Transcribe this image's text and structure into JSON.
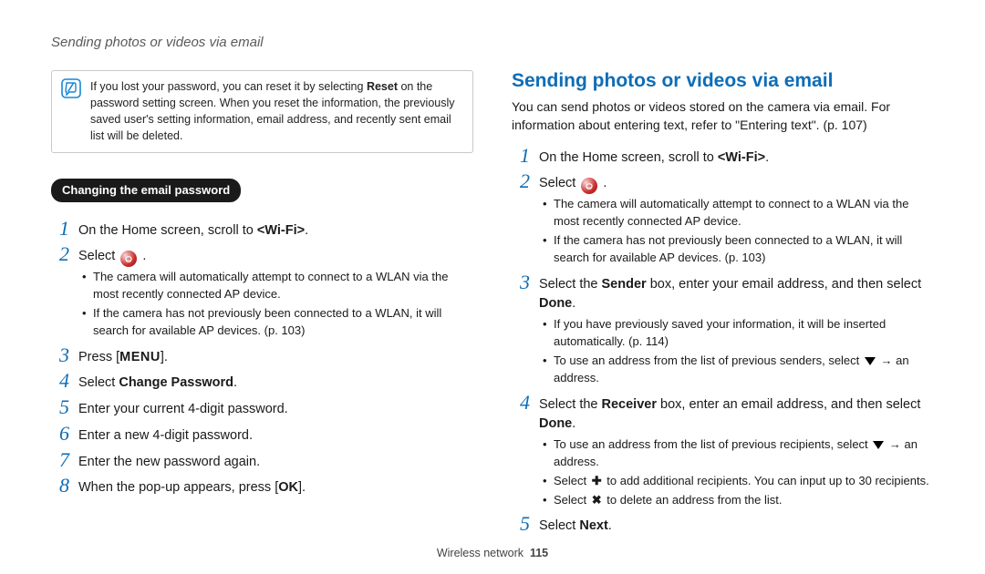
{
  "header": {
    "breadcrumb": "Sending photos or videos via email"
  },
  "tip": {
    "text": "If you lost your password, you can reset it by selecting Reset on the password setting screen. When you reset the information, the previously saved user's setting information, email address, and recently sent email list will be deleted.",
    "reset_word": "Reset"
  },
  "left": {
    "pill": "Changing the email password",
    "steps": [
      {
        "n": "1",
        "body": "On the Home screen, scroll to <Wi-Fi>.",
        "wifi_bold": "<Wi-Fi>"
      },
      {
        "n": "2",
        "body_prefix": "Select ",
        "body_suffix": " .",
        "icon": "email-icon",
        "bullets": [
          "The camera will automatically attempt to connect to a WLAN via the most recently connected AP device.",
          "If the camera has not previously been connected to a WLAN, it will search for available AP devices. (p. 103)"
        ]
      },
      {
        "n": "3",
        "body_prefix": "Press [",
        "body_suffix": "].",
        "glyph": "MENU"
      },
      {
        "n": "4",
        "body_prefix": "Select ",
        "bold": "Change Password",
        "body_suffix": "."
      },
      {
        "n": "5",
        "body": "Enter your current 4-digit password."
      },
      {
        "n": "6",
        "body": "Enter a new 4-digit password."
      },
      {
        "n": "7",
        "body": "Enter the new password again."
      },
      {
        "n": "8",
        "body_prefix": "When the pop-up appears, press [",
        "glyph": "OK",
        "body_suffix": "]."
      }
    ]
  },
  "right": {
    "title": "Sending photos or videos via email",
    "intro": "You can send photos or videos stored on the camera via email. For information about entering text, refer to \"Entering text\". (p. 107)",
    "steps": [
      {
        "n": "1",
        "body": "On the Home screen, scroll to <Wi-Fi>.",
        "wifi_bold": "<Wi-Fi>"
      },
      {
        "n": "2",
        "body_prefix": "Select ",
        "body_suffix": " .",
        "icon": "email-icon",
        "bullets": [
          "The camera will automatically attempt to connect to a WLAN via the most recently connected AP device.",
          "If the camera has not previously been connected to a WLAN, it will search for available AP devices. (p. 103)"
        ]
      },
      {
        "n": "3",
        "prefix": "Select the ",
        "bold1": "Sender",
        "mid": " box, enter your email address, and then select ",
        "bold2": "Done",
        "suffix": ".",
        "bullets": [
          "If you have previously saved your information, it will be inserted automatically. (p. 114)",
          {
            "prefix": "To use an address from the list of previous senders, select ",
            "tri": true,
            "suffix": " → an address."
          }
        ]
      },
      {
        "n": "4",
        "prefix": "Select the ",
        "bold1": "Receiver",
        "mid": " box, enter an email address, and then select ",
        "bold2": "Done",
        "suffix": ".",
        "bullets": [
          {
            "prefix": "To use an address from the list of previous recipients, select ",
            "tri": true,
            "suffix": " → an address."
          },
          {
            "prefix": "Select ",
            "plus": true,
            "suffix": " to add additional recipients. You can input up to 30 recipients."
          },
          {
            "prefix": "Select ",
            "x": true,
            "suffix": " to delete an address from the list."
          }
        ]
      },
      {
        "n": "5",
        "body_prefix": "Select ",
        "bold": "Next",
        "body_suffix": "."
      }
    ]
  },
  "footer": {
    "section": "Wireless network",
    "page": "115"
  }
}
